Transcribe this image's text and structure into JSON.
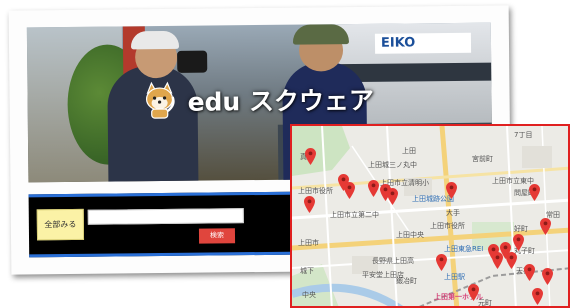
{
  "site": {
    "brand": "edu スクウェア",
    "hero_sign": "EIKO"
  },
  "search_bar": {
    "all_button_label": "全部みる",
    "search_button_label": "検索",
    "search_input_value": "",
    "search_input_placeholder": ""
  },
  "map": {
    "border_color": "#e02020",
    "pin_color": "#e53935",
    "pin_count": 20,
    "labels": [
      "上田城三ノ丸中",
      "上田市立清明小",
      "上田市立第二中",
      "上田市役所",
      "上田市",
      "長野県上田高",
      "平安堂上田店",
      "大手",
      "上田市役所",
      "上田城跡公園",
      "上田東急REI",
      "丸子町",
      "上田駅",
      "上田第一ホテル",
      "上田市立東中",
      "問屋町",
      "中央",
      "上田",
      "天神",
      "真田",
      "元町",
      "好町",
      "7丁目",
      "常田",
      "上田中央",
      "宮前町",
      "城下",
      "鍛冶町"
    ]
  }
}
